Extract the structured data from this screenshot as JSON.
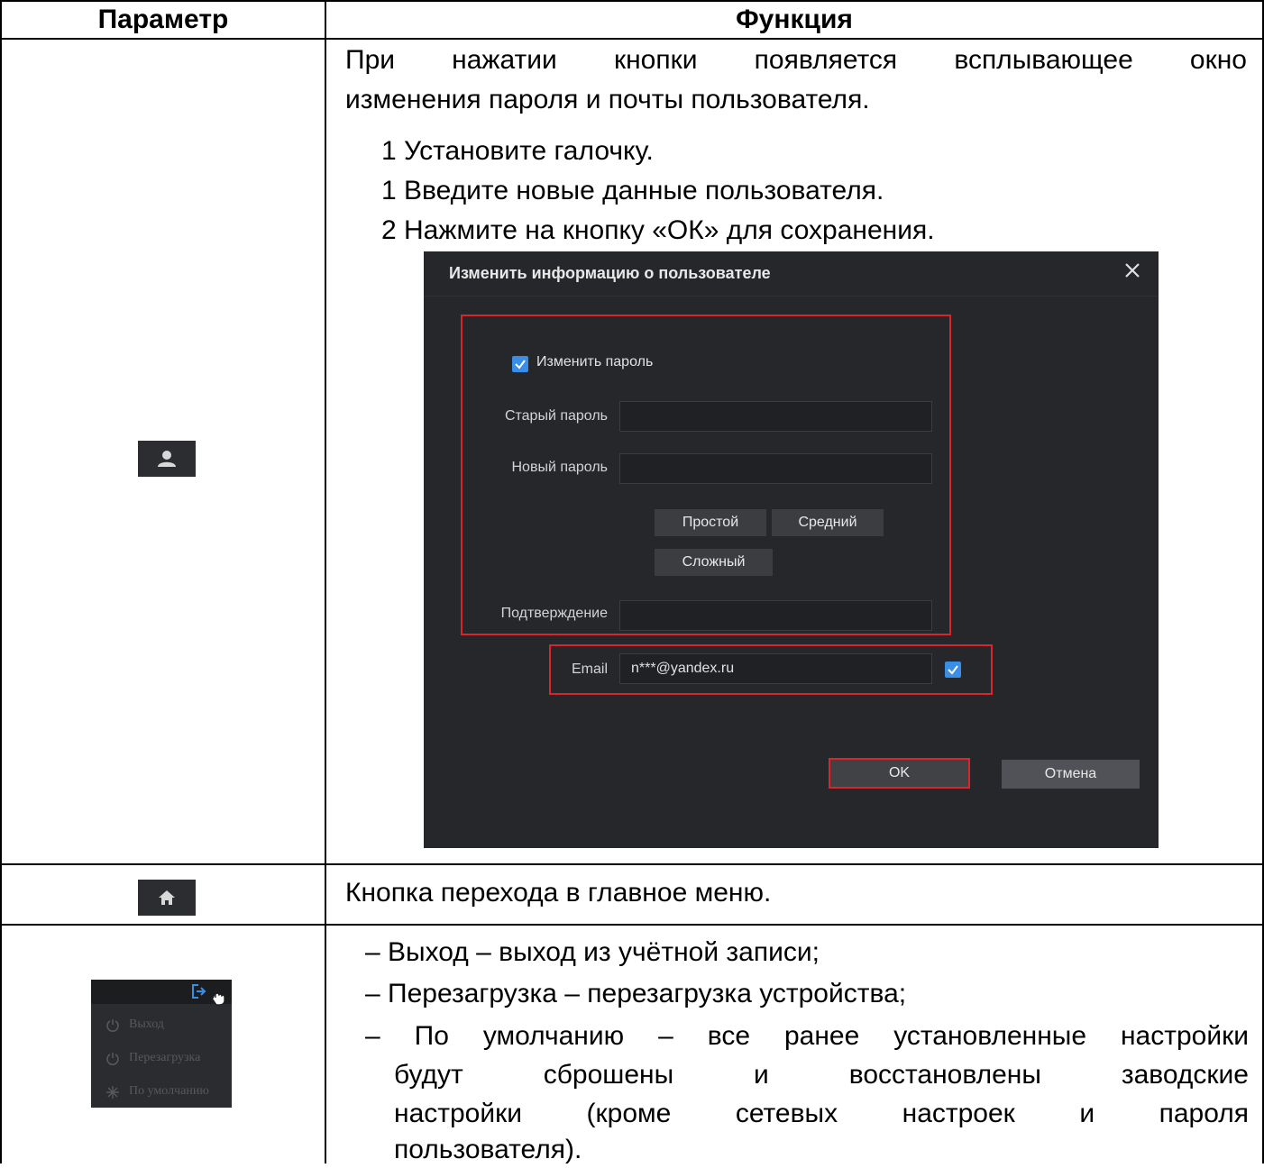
{
  "table": {
    "headers": {
      "param": "Параметр",
      "function": "Функция"
    }
  },
  "row1": {
    "icon": "user-icon",
    "intro_line1": "При нажатии кнопки появляется всплывающее окно",
    "intro_line2": "изменения пароля и почты пользователя.",
    "steps": [
      "1 Установите галочку.",
      "1 Введите новые данные пользователя.",
      "2 Нажмите на кнопку «ОК» для сохранения."
    ],
    "dialog": {
      "title": "Изменить информацию о пользователе",
      "change_password_label": "Изменить пароль",
      "old_password_label": "Старый пароль",
      "new_password_label": "Новый пароль",
      "strength": {
        "simple": "Простой",
        "medium": "Средний",
        "complex": "Сложный"
      },
      "confirm_label": "Подтверждение",
      "email_label": "Email",
      "email_value": "n***@yandex.ru",
      "ok_label": "OK",
      "cancel_label": "Отмена",
      "accent_color": "#3a8ee6",
      "highlight_color": "#d9262b"
    }
  },
  "row2": {
    "icon": "home-icon",
    "text": "Кнопка перехода в главное меню."
  },
  "row3": {
    "thumb": {
      "logout": "Выход",
      "reboot": "Перезагрузка",
      "default": "По умолчанию"
    },
    "items": [
      "– Выход – выход из учётной записи;",
      "– Перезагрузка – перезагрузка устройства;",
      "– По умолчанию – все ранее установленные настройки"
    ],
    "cont_line1": "будут сброшены и восстановлены заводские",
    "cont_line2": "настройки (кроме сетевых настроек и пароля",
    "cont_line3": "пользователя)."
  }
}
